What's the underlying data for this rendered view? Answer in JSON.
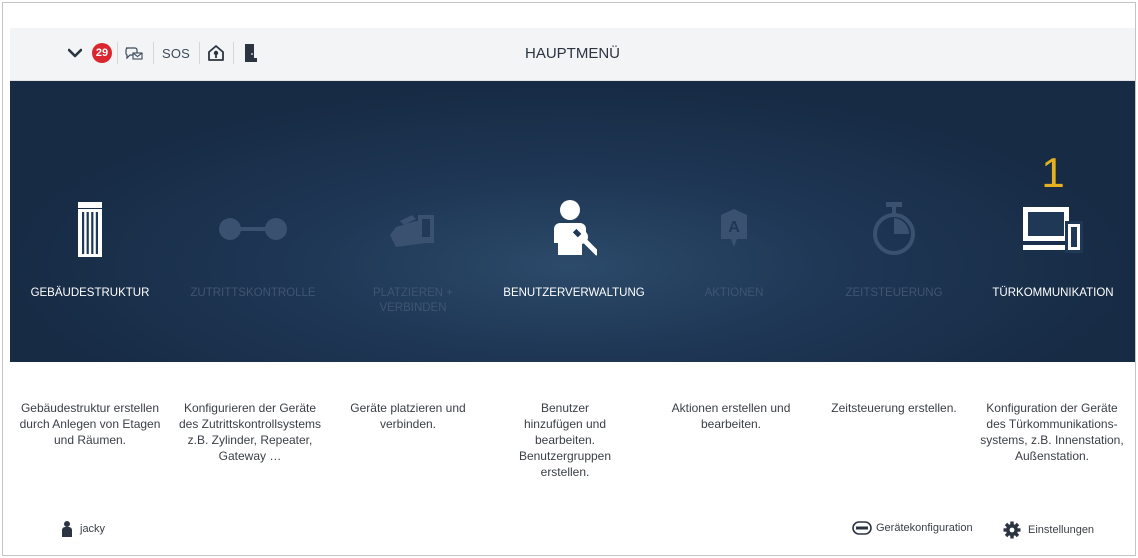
{
  "header": {
    "title": "HAUPTMENÜ",
    "notification_count": "29",
    "sos_label": "SOS",
    "icons": [
      "chevron-down-icon",
      "notification-badge",
      "message-icon",
      "sos-button",
      "home-alarm-icon",
      "door-icon"
    ]
  },
  "tiles": [
    {
      "id": "gebaeudestruktur",
      "label": "GEBÄUDESTRUKTUR",
      "active": true,
      "icon": "building-icon"
    },
    {
      "id": "zutrittskontrolle",
      "label": "ZUTRITTSKONTROLLE",
      "active": false,
      "icon": "access-control-icon"
    },
    {
      "id": "platzieren",
      "label": "PLATZIEREN + VERBINDEN",
      "active": false,
      "icon": "placing-icon"
    },
    {
      "id": "benutzerverwaltung",
      "label": "BENUTZERVERWALTUNG",
      "active": true,
      "icon": "user-management-icon"
    },
    {
      "id": "aktionen",
      "label": "AKTIONEN",
      "active": false,
      "icon": "actions-icon"
    },
    {
      "id": "zeitsteuerung",
      "label": "ZEITSTEUERUNG",
      "active": false,
      "icon": "timer-icon"
    },
    {
      "id": "tuerkommunikation",
      "label": "TÜRKOMMUNIKATION",
      "active": true,
      "icon": "door-communication-icon",
      "count": "1"
    }
  ],
  "descriptions": [
    "Gebäudestruktur erstellen durch Anlegen von Etagen und Räumen.",
    "Konfigurieren der Geräte des Zutrittskontrollsystems z.B. Zylinder, Repeater, Gateway …",
    "Geräte platzieren und verbinden.",
    "Benutzer hinzufügen und bearbeiten. Benutzergruppen erstellen.",
    "Aktionen erstellen und bearbeiten.",
    "Zeitsteuerung erstellen.",
    "Konfiguration der Geräte des Türkommunikations-systems, z.B. Innenstation, Außenstation."
  ],
  "footer": {
    "user_name": "jacky",
    "device_config_label": "Gerätekonfiguration",
    "settings_label": "Einstellungen"
  },
  "colors": {
    "accent_counter": "#e4b21e",
    "badge": "#d9262f",
    "hero_bg": "#1f3856"
  }
}
